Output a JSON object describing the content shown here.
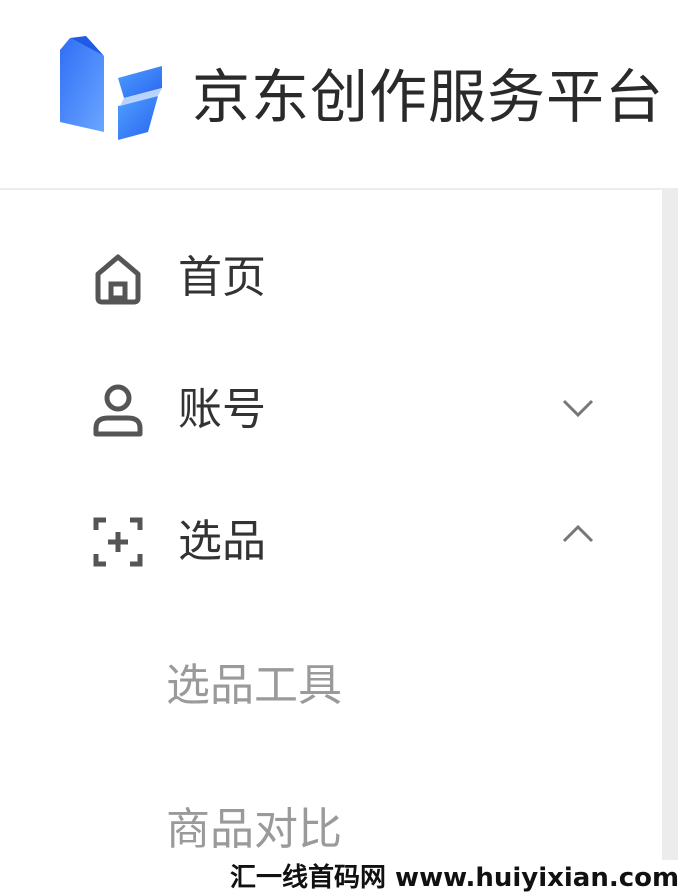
{
  "header": {
    "brand_title": "京东创作服务平台",
    "logo_icon": "jd-creator-logo",
    "accent_color": "#3d7bf7"
  },
  "sidebar": {
    "items": [
      {
        "label": "首页",
        "icon": "home-icon"
      },
      {
        "label": "账号",
        "icon": "user-icon",
        "chevron": "chevron-down-icon"
      },
      {
        "label": "选品",
        "icon": "scan-plus-icon",
        "chevron": "chevron-up-icon",
        "children": [
          {
            "label": "选品工具"
          },
          {
            "label": "商品对比"
          }
        ]
      }
    ]
  },
  "watermark": {
    "text": "汇一线首码网 www.huiyixian.com"
  }
}
